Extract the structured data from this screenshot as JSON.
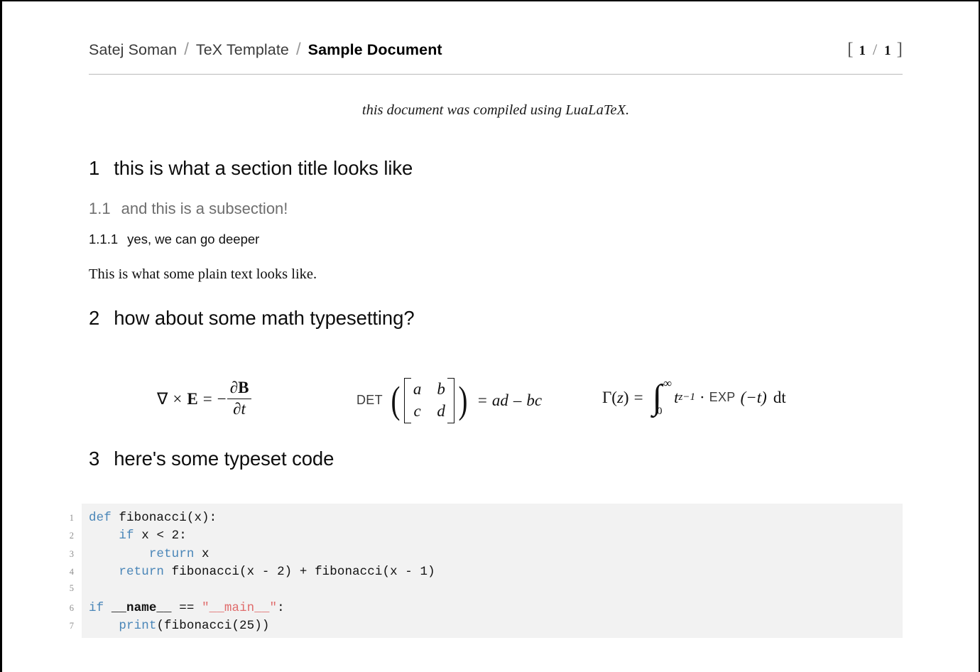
{
  "header": {
    "breadcrumbs": [
      {
        "label": "Satej Soman",
        "current": false
      },
      {
        "label": "TeX Template",
        "current": false
      },
      {
        "label": "Sample Document",
        "current": true
      }
    ],
    "separator": "/",
    "page_indicator": {
      "open_bracket": "[",
      "current_page": "1",
      "slash": "/",
      "total_pages": "1",
      "close_bracket": "]"
    }
  },
  "subtitle": "this document was compiled using LuaLaTeX.",
  "sections": {
    "s1": {
      "number": "1",
      "title": "this is what a section title looks like"
    },
    "s1_1": {
      "number": "1.1",
      "title": "and this is a subsection!"
    },
    "s1_1_1": {
      "number": "1.1.1",
      "title": "yes, we can go deeper"
    },
    "body1": "This is what some plain text looks like.",
    "s2": {
      "number": "2",
      "title": "how about some math typesetting?"
    },
    "s3": {
      "number": "3",
      "title": "here's some typeset code"
    }
  },
  "math": {
    "eq1": {
      "nabla": "∇",
      "times": "×",
      "E": "E",
      "equals": "=",
      "minus": "−",
      "numerator_partial": "∂",
      "numerator_B": "B",
      "denominator_partial": "∂",
      "denominator_t": "t"
    },
    "eq2": {
      "operator": "DET",
      "matrix": [
        [
          "a",
          "b"
        ],
        [
          "c",
          "d"
        ]
      ],
      "equals": "=",
      "result_ad": "ad",
      "result_minus": "–",
      "result_bc": "bc"
    },
    "eq3": {
      "gamma": "Γ",
      "arg_open": "(",
      "arg_z": "z",
      "arg_close": ")",
      "equals": "=",
      "integral": "∫",
      "upper_limit": "∞",
      "lower_limit": "0",
      "t": "t",
      "exponent": "z−1",
      "cdot": "·",
      "exp_operator": "EXP",
      "exp_arg": "(−t)",
      "differential": "dt"
    }
  },
  "code": {
    "language": "python",
    "lines": [
      {
        "number": "1",
        "tokens": [
          {
            "t": "def ",
            "c": "kw"
          },
          {
            "t": "fibonacci(x):",
            "c": ""
          }
        ]
      },
      {
        "number": "2",
        "tokens": [
          {
            "t": "    ",
            "c": ""
          },
          {
            "t": "if ",
            "c": "kw"
          },
          {
            "t": "x < 2:",
            "c": ""
          }
        ]
      },
      {
        "number": "3",
        "tokens": [
          {
            "t": "        ",
            "c": ""
          },
          {
            "t": "return ",
            "c": "kw"
          },
          {
            "t": "x",
            "c": ""
          }
        ]
      },
      {
        "number": "4",
        "tokens": [
          {
            "t": "    ",
            "c": ""
          },
          {
            "t": "return ",
            "c": "kw"
          },
          {
            "t": "fibonacci(x - 2) + fibonacci(x - 1)",
            "c": ""
          }
        ]
      },
      {
        "number": "5",
        "tokens": [
          {
            "t": "",
            "c": ""
          }
        ]
      },
      {
        "number": "6",
        "tokens": [
          {
            "t": "if ",
            "c": "kw"
          },
          {
            "t": "__name__",
            "c": "bld"
          },
          {
            "t": " == ",
            "c": ""
          },
          {
            "t": "\"__main__\"",
            "c": "str"
          },
          {
            "t": ":",
            "c": ""
          }
        ]
      },
      {
        "number": "7",
        "tokens": [
          {
            "t": "    ",
            "c": ""
          },
          {
            "t": "print",
            "c": "fn"
          },
          {
            "t": "(fibonacci(25))",
            "c": ""
          }
        ]
      }
    ]
  },
  "colors": {
    "keyword": "#4a86b8",
    "string": "#e06c6c",
    "code_background": "#f2f2f2",
    "subsection_gray": "#6e6e6e",
    "rule": "#b9b9b9"
  }
}
